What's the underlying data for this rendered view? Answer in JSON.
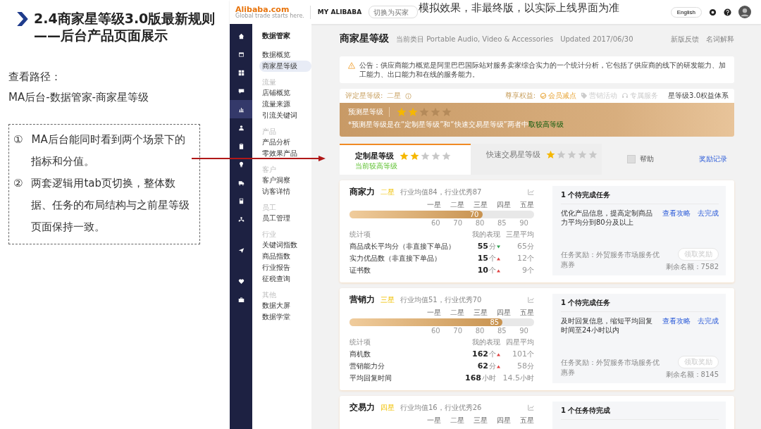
{
  "slide": {
    "title": [
      "2.4商家星等级3.0版最新规则",
      "——后台产品页面展示"
    ],
    "path_label": "查看路径：",
    "path": "MA后台-数据管家-商家星等级",
    "notes": [
      {
        "number": "①",
        "text": "MA后台能同时看到两个场景下的指标和分值。"
      },
      {
        "number": "②",
        "text": "两套逻辑用tab页切换，整体数据、任务的布局结构与之前星等级页面保持一致。"
      }
    ],
    "overlay_note": "模拟效果，非最终版，以实际上线界面为准"
  },
  "header": {
    "logo": "Alibaba.com",
    "tagline": "Global trade starts here.",
    "brand": "MY ALIBABA",
    "search": {
      "placeholder": "切换为买家"
    },
    "language": "English"
  },
  "rail": [
    {
      "kind": "home",
      "selected": false
    },
    {
      "kind": "window",
      "selected": false
    },
    {
      "kind": "grid",
      "selected": false
    },
    {
      "kind": "chat",
      "selected": false
    },
    {
      "kind": "chart",
      "selected": true
    },
    {
      "kind": "user",
      "selected": false
    },
    {
      "kind": "clipboard",
      "selected": false
    },
    {
      "kind": "bulb",
      "selected": false
    },
    {
      "kind": "truck",
      "selected": false
    },
    {
      "kind": "calculator",
      "selected": false
    },
    {
      "kind": "network",
      "selected": false
    },
    {
      "kind": "send",
      "selected": false
    },
    {
      "kind": "heart",
      "selected": false
    },
    {
      "kind": "briefcase",
      "selected": false
    }
  ],
  "sidebar": {
    "title": "数据管家",
    "groups": [
      {
        "items": [
          {
            "label": "数据概览",
            "selected": false
          },
          {
            "label": "商家星等级",
            "selected": true
          }
        ]
      },
      {
        "heading": "流量",
        "items": [
          {
            "label": "店铺概览",
            "selected": false
          },
          {
            "label": "流量来源",
            "selected": false
          },
          {
            "label": "引流关键词",
            "selected": false
          }
        ]
      },
      {
        "heading": "产品",
        "items": [
          {
            "label": "产品分析",
            "selected": false
          },
          {
            "label": "零效果产品",
            "selected": false
          }
        ]
      },
      {
        "heading": "客户",
        "items": [
          {
            "label": "客户洞察",
            "selected": false
          },
          {
            "label": "访客详情",
            "selected": false
          }
        ]
      },
      {
        "heading": "员工",
        "items": [
          {
            "label": "员工管理",
            "selected": false
          }
        ]
      },
      {
        "heading": "行业",
        "items": [
          {
            "label": "关键词指数",
            "selected": false
          },
          {
            "label": "商品指数",
            "selected": false
          },
          {
            "label": "行业报告",
            "selected": false
          },
          {
            "label": "征税查询",
            "selected": false
          }
        ]
      },
      {
        "heading": "其他",
        "items": [
          {
            "label": "数据大屏",
            "selected": false
          },
          {
            "label": "数据学堂",
            "selected": false
          }
        ]
      }
    ]
  },
  "page": {
    "title": "商家星等级",
    "category": "当前类目 Portable Audio, Video & Accessories",
    "updated": "Updated 2017/06/30",
    "links": [
      "新版反馈",
      "名词解释"
    ],
    "notice": "公告：供应商能力概览是阿里巴巴国际站对服务卖家综合实力的一个统计分析，它包括了供应商的线下的研发能力、加工能力、出口能力和在线的服务能力。",
    "rating": {
      "label": "评定星等级:",
      "value": "二星",
      "benefits_label": "尊享权益:",
      "benefits": [
        {
          "kind": "check",
          "label": "会员减点",
          "active": true
        },
        {
          "kind": "tag",
          "label": "营销活动",
          "active": false
        },
        {
          "kind": "headset",
          "label": "专属服务",
          "active": false
        }
      ],
      "system_link": "星等级3.0权益体系"
    },
    "banner": {
      "label": "预测星等级",
      "stars": 2,
      "note": "*预测星等级是在“定制星等级”和“快速交易星等级”两者中",
      "note_highlight": "取较高等级"
    },
    "tabs": [
      {
        "label": "定制星等级",
        "stars": 2,
        "sub": "当前较高等级",
        "selected": true
      },
      {
        "label": "快速交易星等级",
        "stars": 1,
        "selected": false
      }
    ],
    "help": {
      "label": "帮助",
      "checked": false
    },
    "rewards_link": "奖励记录",
    "sections": [
      {
        "title": "商家力",
        "level": "二星",
        "industry": "行业均值84，行业优秀87",
        "scale": [
          "一星",
          "二星",
          "三星",
          "四星",
          "五星"
        ],
        "bar": {
          "level": 0.72,
          "value": "70"
        },
        "ticks": [
          "60",
          "70",
          "80",
          "85",
          "90"
        ],
        "columns": [
          "统计项",
          "我的表现",
          "三星平均"
        ],
        "rows": [
          {
            "name": "商品成长平均分（非直接下单品）",
            "mine": "55",
            "mine_unit": "分",
            "kind": "down",
            "avg": "65",
            "avg_unit": "分"
          },
          {
            "name": "实力优品数（非直接下单品）",
            "mine": "15",
            "mine_unit": "个",
            "kind": "up",
            "avg": "12",
            "avg_unit": "个"
          },
          {
            "name": "证书数",
            "mine": "10",
            "mine_unit": "个",
            "kind": "up",
            "avg": "9",
            "avg_unit": "个"
          }
        ],
        "tasks": {
          "count": "1 个待完成任务",
          "items": [
            {
              "text": "优化产品信息，提高定制商品力平均分到80分及以上",
              "links": [
                "查看攻略",
                "去完成"
              ]
            }
          ],
          "reward": "任务奖励：外贸服务市场服务优惠券",
          "claim": {
            "label": "领取奖励",
            "disabled": true
          },
          "remaining": "剩余名额：7582"
        }
      },
      {
        "title": "营销力",
        "level": "三星",
        "industry": "行业均值51，行业优秀70",
        "scale": [
          "一星",
          "二星",
          "三星",
          "四星",
          "五星"
        ],
        "bar": {
          "level": 0.83,
          "value": "85"
        },
        "ticks": [
          "60",
          "70",
          "80",
          "85",
          "90"
        ],
        "columns": [
          "统计项",
          "我的表现",
          "四星平均"
        ],
        "rows": [
          {
            "name": "商机数",
            "mine": "162",
            "mine_unit": "个",
            "kind": "up",
            "avg": "101",
            "avg_unit": "个"
          },
          {
            "name": "营销能力分",
            "mine": "62",
            "mine_unit": "分",
            "kind": "up",
            "avg": "58",
            "avg_unit": "分"
          },
          {
            "name": "平均回复时间",
            "mine": "168",
            "mine_unit": "小时",
            "kind": "plain",
            "avg": "14.5",
            "avg_unit": "小时"
          }
        ],
        "tasks": {
          "count": "1 个待完成任务",
          "items": [
            {
              "text": "及时回复信息，缩短平均回复时间至24小时以内",
              "links": [
                "查看攻略",
                "去完成"
              ]
            }
          ],
          "reward": "任务奖励：外贸服务市场服务优惠券",
          "claim": {
            "label": "领取奖励",
            "disabled": true
          },
          "remaining": "剩余名额：8145"
        }
      },
      {
        "title": "交易力",
        "level": "四星",
        "industry": "行业均值16，行业优秀26",
        "scale": [
          "一星",
          "二星",
          "三星",
          "四星",
          "五星"
        ],
        "tasks": {
          "count": "1 个任务待完成"
        }
      }
    ]
  }
}
